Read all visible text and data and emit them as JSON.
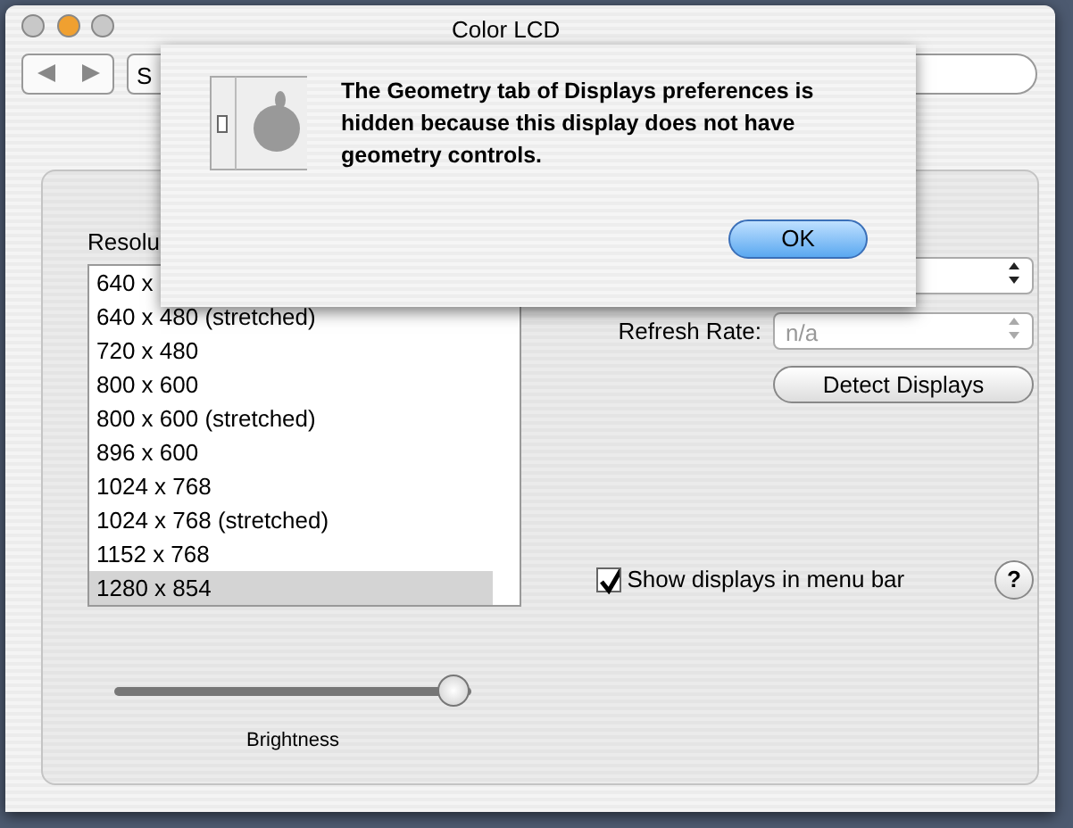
{
  "window": {
    "title": "Color LCD",
    "buttons": [
      {
        "color": "#c8c8c8"
      },
      {
        "color": "#f0a030"
      },
      {
        "color": "#c8c8c8"
      }
    ]
  },
  "toolbar": {
    "show_all": "S"
  },
  "resolutions": {
    "label": "Resolu",
    "items": [
      {
        "text": "640 x",
        "selected": false
      },
      {
        "text": "640 x 480 (stretched)",
        "selected": false
      },
      {
        "text": "720 x 480",
        "selected": false
      },
      {
        "text": "800 x 600",
        "selected": false
      },
      {
        "text": "800 x 600 (stretched)",
        "selected": false
      },
      {
        "text": "896 x 600",
        "selected": false
      },
      {
        "text": "1024 x 768",
        "selected": false
      },
      {
        "text": "1024 x 768 (stretched)",
        "selected": false
      },
      {
        "text": "1152 x 768",
        "selected": false
      },
      {
        "text": "1280 x 854",
        "selected": true
      }
    ]
  },
  "refresh_rate": {
    "label": "Refresh Rate:",
    "value": "n/a",
    "disabled": true
  },
  "detect_button": "Detect Displays",
  "menu_bar_checkbox": {
    "label": "Show displays in menu bar",
    "checked": true
  },
  "help": "?",
  "brightness": {
    "label": "Brightness",
    "level": 0.95
  },
  "alert": {
    "message": "The Geometry tab of Displays preferences is hidden because this display does not have geometry controls.",
    "button": "OK"
  }
}
